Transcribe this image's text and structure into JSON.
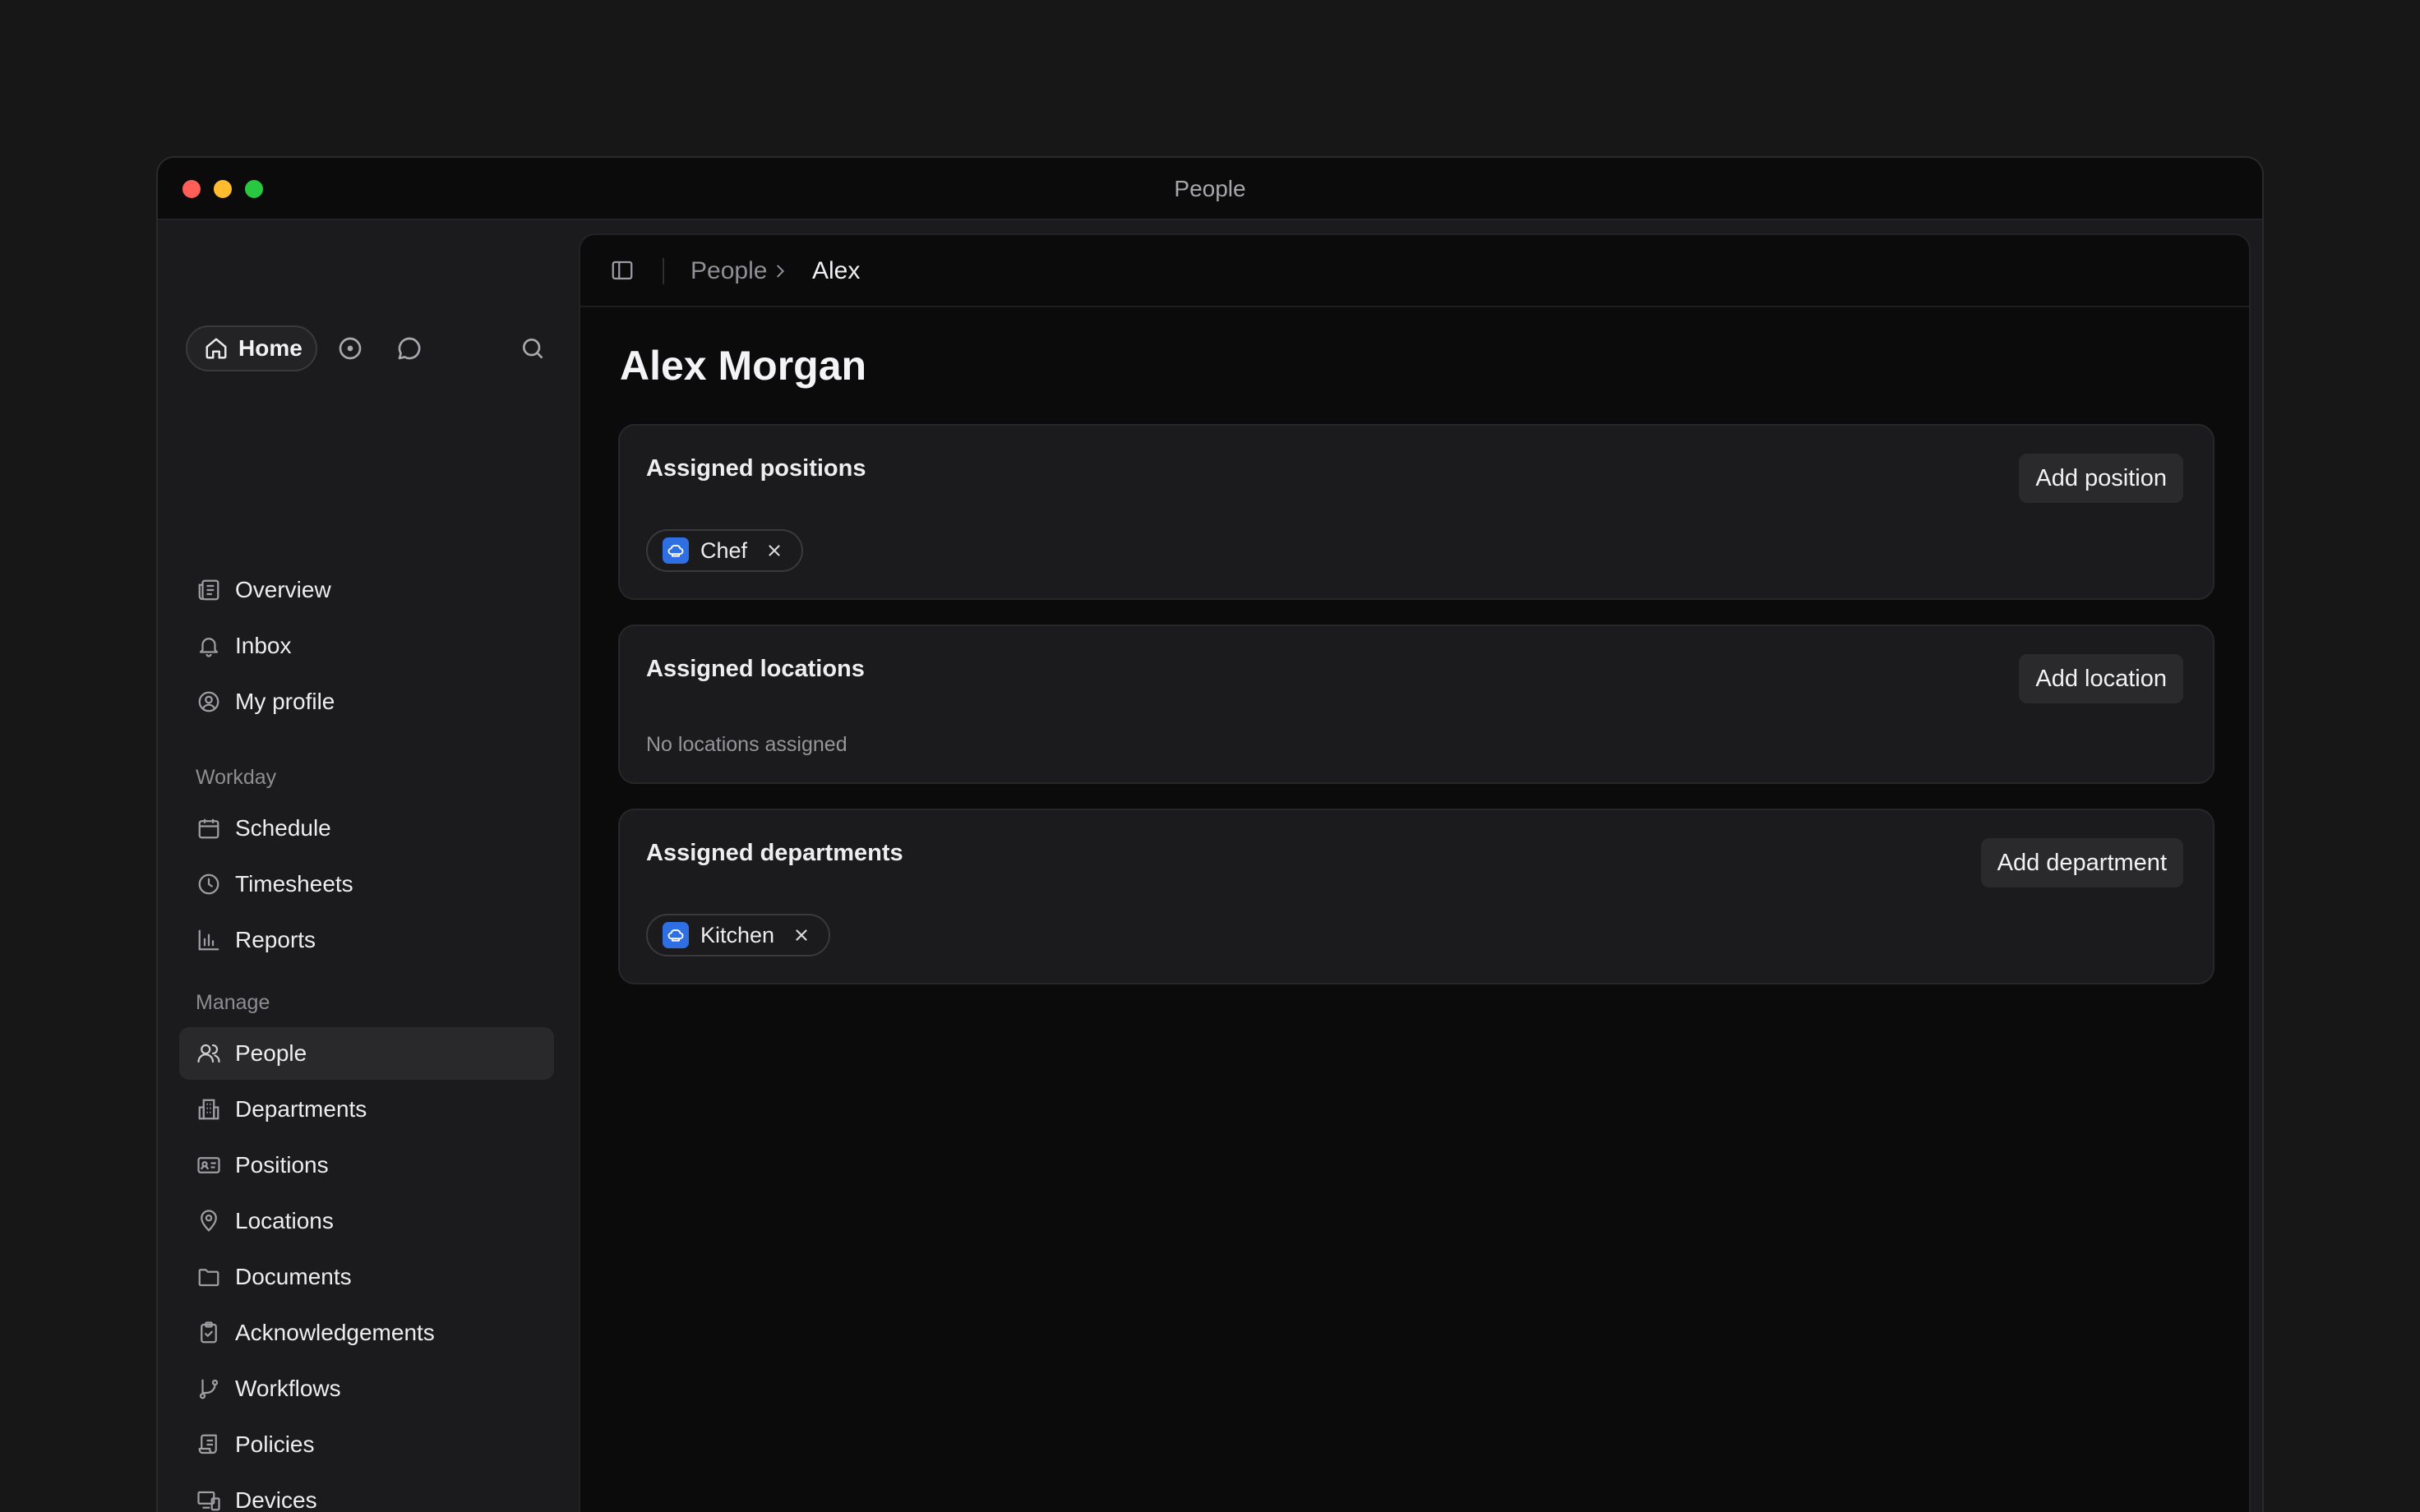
{
  "window": {
    "title": "People"
  },
  "sidebar": {
    "home_label": "Home",
    "top_icons": [
      "home-icon",
      "circle-dot-icon",
      "chat-icon",
      "search-icon"
    ],
    "primary": [
      {
        "label": "Overview",
        "icon": "newspaper-icon"
      },
      {
        "label": "Inbox",
        "icon": "bell-icon"
      },
      {
        "label": "My profile",
        "icon": "user-circle-icon"
      }
    ],
    "sections": [
      {
        "label": "Workday",
        "items": [
          {
            "label": "Schedule",
            "icon": "calendar-icon"
          },
          {
            "label": "Timesheets",
            "icon": "clock-icon"
          },
          {
            "label": "Reports",
            "icon": "bar-chart-icon"
          }
        ]
      },
      {
        "label": "Manage",
        "items": [
          {
            "label": "People",
            "icon": "users-icon",
            "active": true
          },
          {
            "label": "Departments",
            "icon": "building-icon"
          },
          {
            "label": "Positions",
            "icon": "id-card-icon"
          },
          {
            "label": "Locations",
            "icon": "map-pin-icon"
          },
          {
            "label": "Documents",
            "icon": "folder-icon"
          },
          {
            "label": "Acknowledgements",
            "icon": "clipboard-check-icon"
          },
          {
            "label": "Workflows",
            "icon": "git-branch-icon"
          },
          {
            "label": "Policies",
            "icon": "scroll-icon"
          },
          {
            "label": "Devices",
            "icon": "devices-icon"
          }
        ]
      }
    ]
  },
  "breadcrumb": {
    "parent": "People",
    "current": "Alex"
  },
  "page": {
    "title": "Alex Morgan"
  },
  "cards": {
    "positions": {
      "title": "Assigned positions",
      "button": "Add position",
      "chips": [
        {
          "label": "Chef",
          "icon": "chef-hat-icon"
        }
      ]
    },
    "locations": {
      "title": "Assigned locations",
      "button": "Add location",
      "empty": "No locations assigned"
    },
    "departments": {
      "title": "Assigned departments",
      "button": "Add department",
      "chips": [
        {
          "label": "Kitchen",
          "icon": "chef-hat-icon"
        }
      ]
    }
  },
  "colors": {
    "accent_chip": "#2f6fe4",
    "background": "#0b0b0c",
    "card": "#1b1b1d"
  }
}
